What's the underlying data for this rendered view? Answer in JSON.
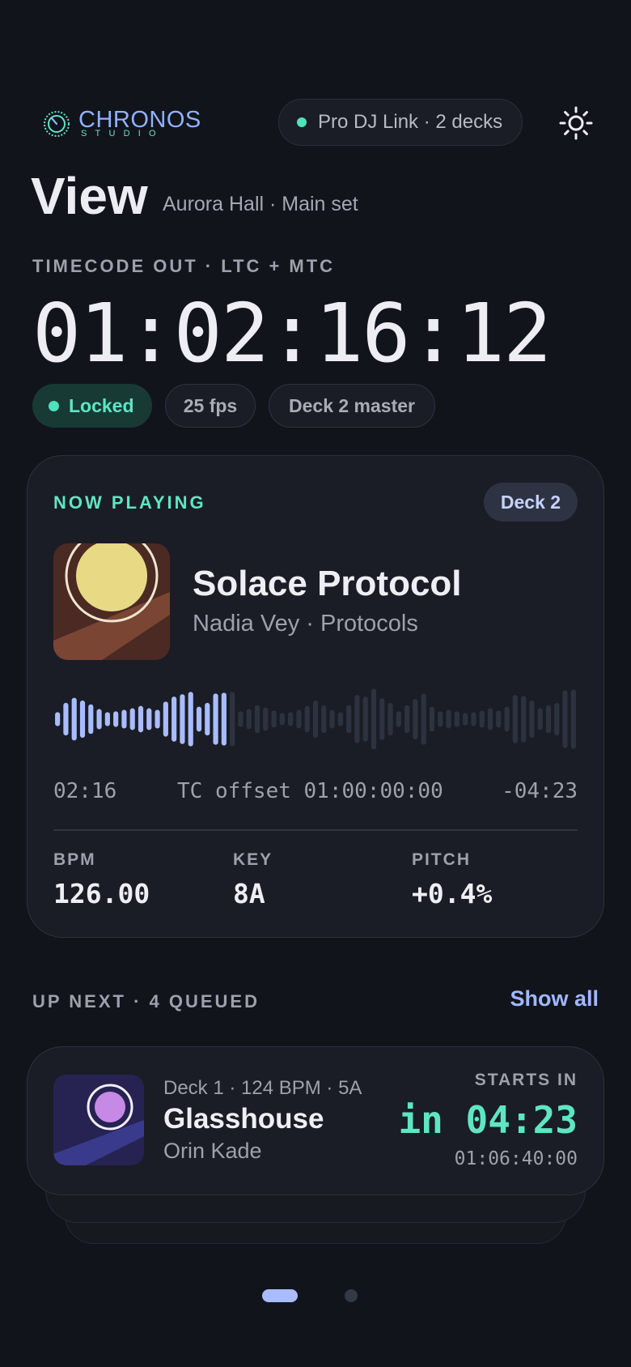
{
  "header": {
    "logo_text": "CHRONOS",
    "logo_sub": "STUDIO",
    "link_status": "Pro DJ Link · 2 decks",
    "theme_icon": "sun-icon"
  },
  "view": {
    "title": "View",
    "subtitle": "Aurora Hall · Main set"
  },
  "timecode": {
    "label": "TIMECODE OUT · LTC + MTC",
    "value": "01:02:16:12",
    "chips": {
      "locked": "Locked",
      "fps": "25 fps",
      "master": "Deck 2 master"
    }
  },
  "now_playing": {
    "label": "NOW PLAYING",
    "deck": "Deck 2",
    "title": "Solace Protocol",
    "subtitle": "Nadia Vey · Protocols",
    "progress": 0.34,
    "elapsed": "02:16",
    "tc_offset": "TC offset 01:00:00:00",
    "remaining": "-04:23",
    "stats": {
      "bpm_label": "BPM",
      "bpm_value": "126.00",
      "key_label": "KEY",
      "key_value": "8A",
      "pitch_label": "PITCH",
      "pitch_value": "+0.4%"
    },
    "waveform": [
      0.18,
      0.42,
      0.55,
      0.48,
      0.38,
      0.26,
      0.18,
      0.2,
      0.24,
      0.28,
      0.34,
      0.28,
      0.24,
      0.45,
      0.58,
      0.64,
      0.7,
      0.32,
      0.42,
      0.66,
      0.68,
      0.7,
      0.2,
      0.26,
      0.36,
      0.3,
      0.22,
      0.16,
      0.18,
      0.24,
      0.34,
      0.48,
      0.36,
      0.24,
      0.18,
      0.36,
      0.62,
      0.58,
      0.78,
      0.54,
      0.42,
      0.2,
      0.36,
      0.52,
      0.66,
      0.32,
      0.2,
      0.24,
      0.2,
      0.16,
      0.18,
      0.22,
      0.28,
      0.22,
      0.32,
      0.62,
      0.6,
      0.48,
      0.28,
      0.36,
      0.42,
      0.74,
      0.76
    ],
    "colors": {
      "played": "#a9bcff",
      "unplayed": "#2d3240",
      "accent": "#5ee6c4"
    }
  },
  "up_next": {
    "label": "UP NEXT · 4 QUEUED",
    "show_all": "Show all",
    "item": {
      "meta": "Deck 1 · 124 BPM · 5A",
      "title": "Glasshouse",
      "artist": "Orin Kade",
      "starts_label": "STARTS IN",
      "starts_value": "in 04:23",
      "starts_tc": "01:06:40:00"
    }
  },
  "pager": {
    "pages": 2,
    "active": 1
  }
}
